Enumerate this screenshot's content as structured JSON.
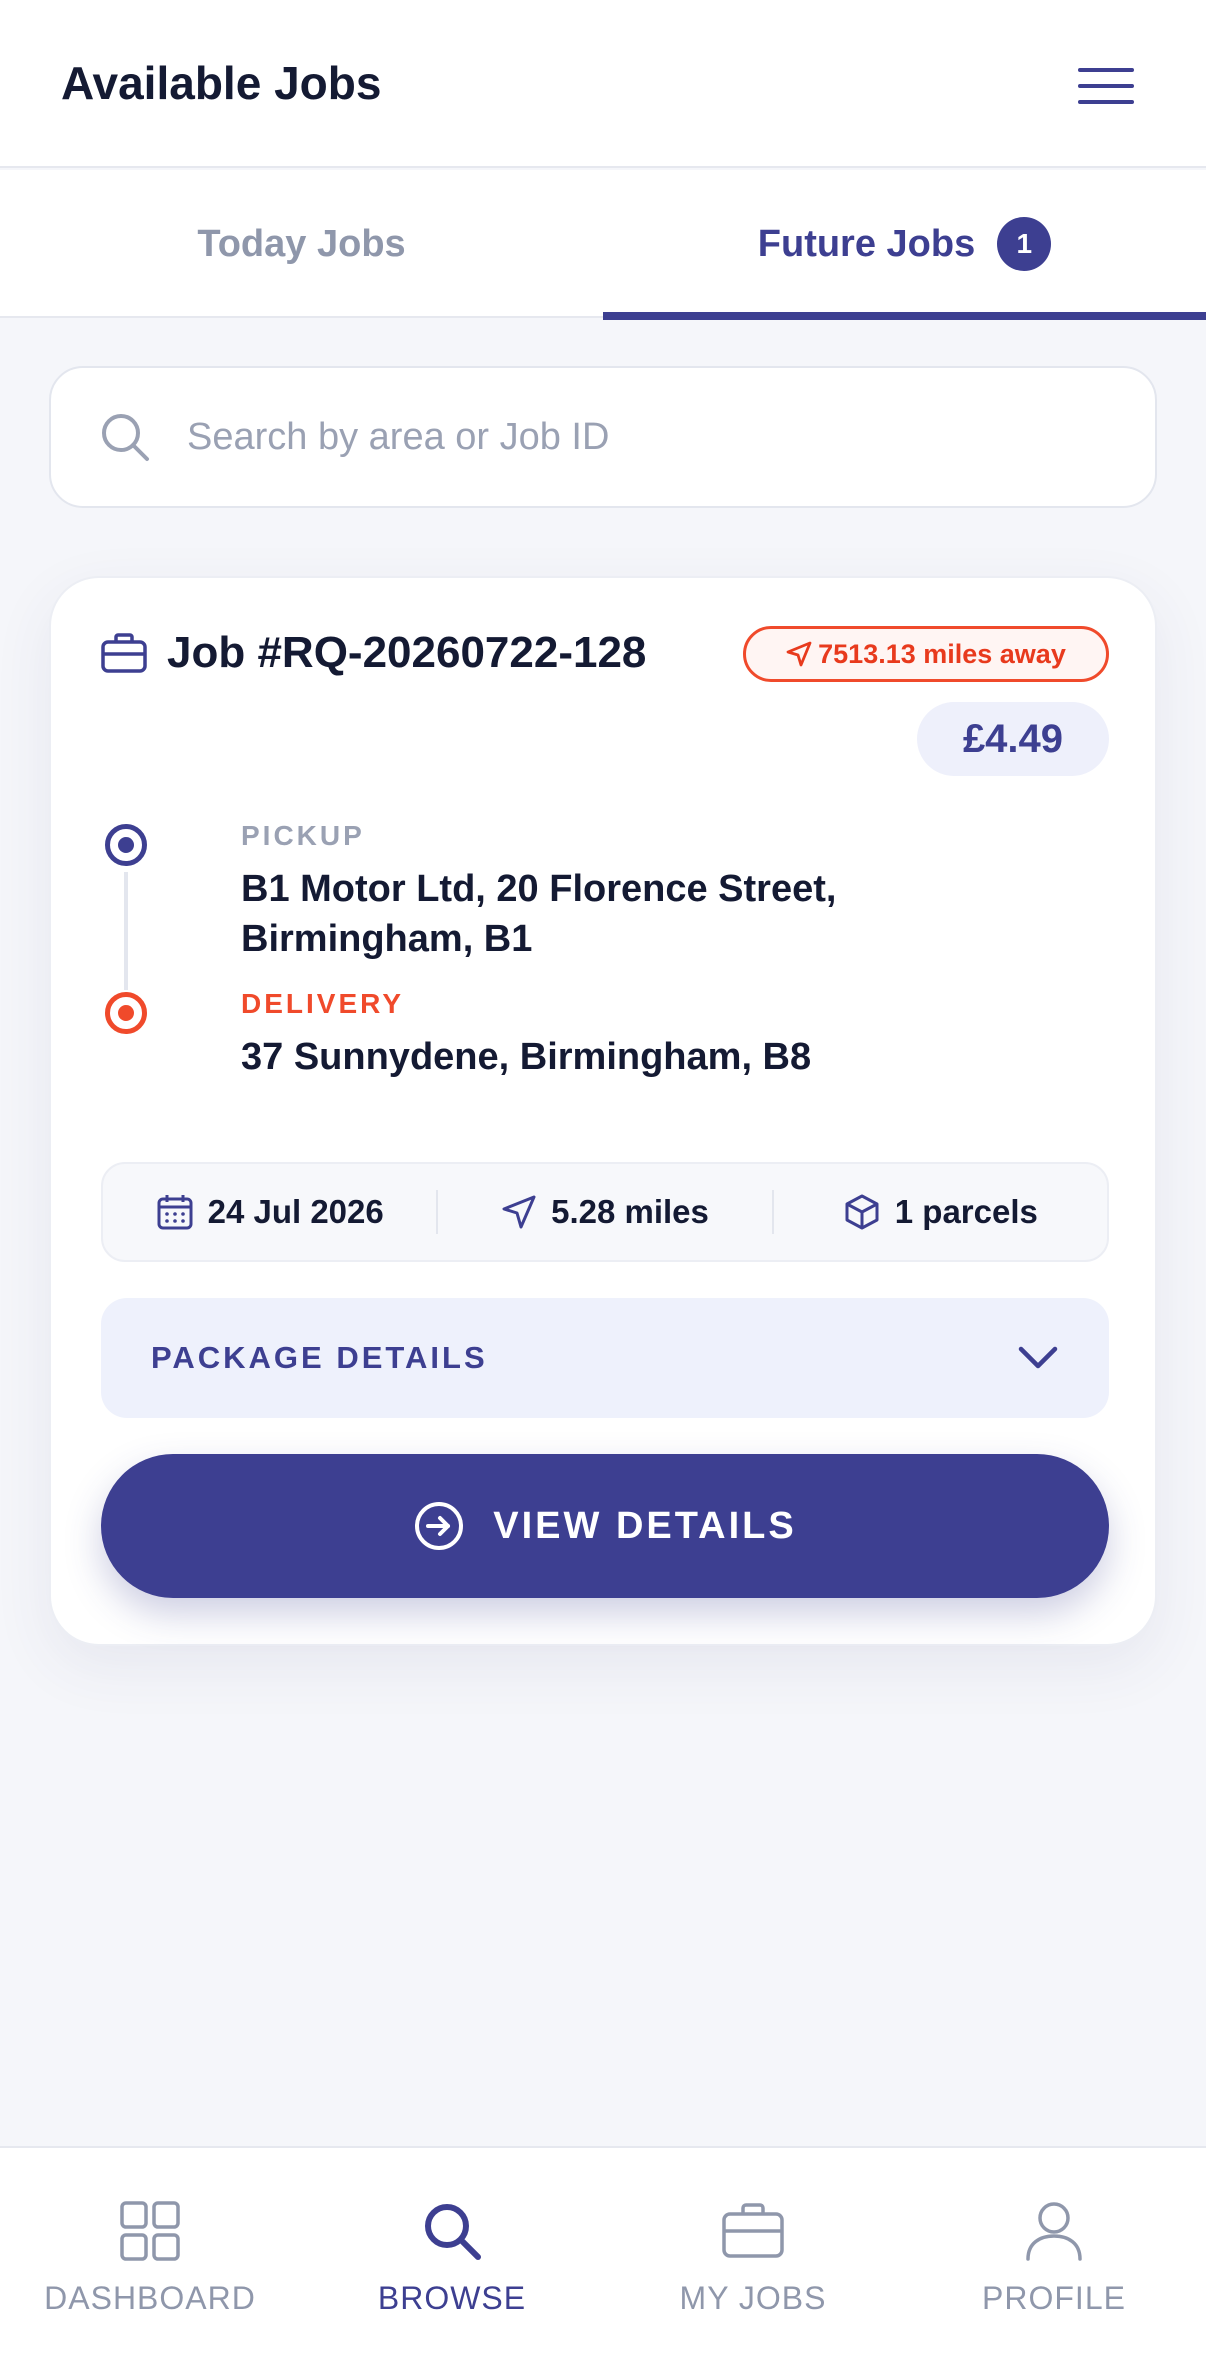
{
  "header": {
    "title": "Available Jobs"
  },
  "tabs": [
    {
      "label": "Today Jobs"
    },
    {
      "label": "Future Jobs",
      "badge": "1"
    }
  ],
  "search": {
    "placeholder": "Search by area or Job ID",
    "value": ""
  },
  "job": {
    "id": "Job #RQ-20260722-128",
    "distance_away": "7513.13 miles away",
    "price": "£4.49",
    "pickup": {
      "label": "PICKUP",
      "address": "B1 Motor Ltd, 20 Florence Street, Birmingham, B1"
    },
    "delivery": {
      "label": "DELIVERY",
      "address": "37 Sunnydene, Birmingham, B8"
    },
    "meta": {
      "date": "24 Jul 2026",
      "distance": "5.28 miles",
      "parcels": "1 parcels"
    },
    "package_details_label": "PACKAGE DETAILS",
    "view_details_label": "VIEW DETAILS"
  },
  "bottom_nav": [
    {
      "label": "DASHBOARD",
      "icon": "grid-icon"
    },
    {
      "label": "BROWSE",
      "icon": "search-icon",
      "active": true
    },
    {
      "label": "MY JOBS",
      "icon": "briefcase-icon"
    },
    {
      "label": "PROFILE",
      "icon": "user-icon"
    }
  ],
  "colors": {
    "accent": "#3d3f91",
    "alert": "#f04a2b",
    "muted": "#8f97ab"
  }
}
